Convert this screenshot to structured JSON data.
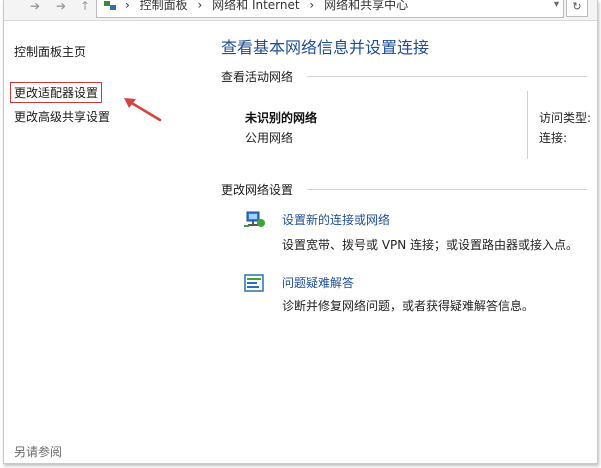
{
  "breadcrumb": [
    "控制面板",
    "网络和 Internet",
    "网络和共享中心"
  ],
  "left_nav": {
    "home": "控制面板主页",
    "change_adapter": "更改适配器设置",
    "change_sharing": "更改高级共享设置",
    "see_also": "另请参阅"
  },
  "main": {
    "title": "查看基本网络信息并设置连接",
    "active_networks_header": "查看活动网络",
    "network_name": "未识别的网络",
    "network_category": "公用网络",
    "access_type_label": "访问类型:",
    "connections_label": "连接:",
    "change_settings_header": "更改网络设置",
    "tasks": [
      {
        "link": "设置新的连接或网络",
        "desc": "设置宽带、拨号或 VPN 连接；或设置路由器或接入点。",
        "icon": "network-setup-icon"
      },
      {
        "link": "问题疑难解答",
        "desc": "诊断并修复网络问题，或者获得疑难解答信息。",
        "icon": "troubleshoot-icon"
      }
    ]
  },
  "colors": {
    "link_blue": "#1e4e96",
    "highlight_red": "#c83a3a"
  }
}
